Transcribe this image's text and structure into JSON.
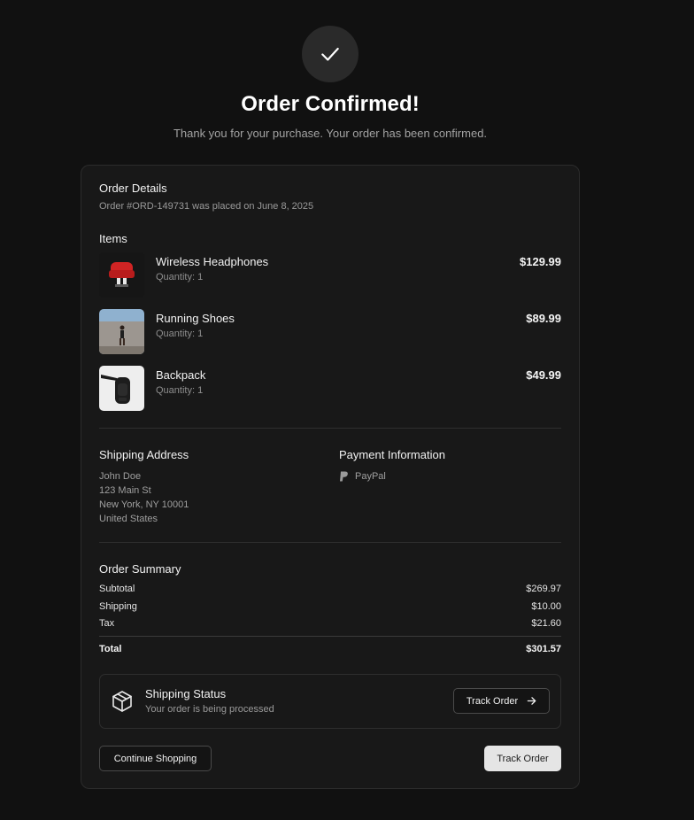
{
  "header": {
    "title": "Order Confirmed!",
    "subtitle": "Thank you for your purchase. Your order has been confirmed."
  },
  "order": {
    "heading": "Order Details",
    "placed_text": "Order #ORD-149731 was placed on June 8, 2025"
  },
  "items": {
    "heading": "Items",
    "list": [
      {
        "name": "Wireless Headphones",
        "quantity": "Quantity: 1",
        "price": "$129.99"
      },
      {
        "name": "Running Shoes",
        "quantity": "Quantity: 1",
        "price": "$89.99"
      },
      {
        "name": "Backpack",
        "quantity": "Quantity: 1",
        "price": "$49.99"
      }
    ]
  },
  "shipping_address": {
    "heading": "Shipping Address",
    "lines": [
      "John Doe",
      "123 Main St",
      "New York, NY 10001",
      "United States"
    ]
  },
  "payment": {
    "heading": "Payment Information",
    "method": "PayPal",
    "icon": "paypal-icon"
  },
  "summary": {
    "heading": "Order Summary",
    "rows": [
      {
        "label": "Subtotal",
        "value": "$269.97"
      },
      {
        "label": "Shipping",
        "value": "$10.00"
      },
      {
        "label": "Tax",
        "value": "$21.60"
      }
    ],
    "total_label": "Total",
    "total_value": "$301.57"
  },
  "shipping_status": {
    "title": "Shipping Status",
    "status": "Your order is being processed",
    "track_label": "Track Order",
    "icon": "package-icon"
  },
  "actions": {
    "continue_label": "Continue Shopping",
    "track_label": "Track Order"
  },
  "colors": {
    "background": "#111111",
    "card": "#181818",
    "primary_button": "#e5e5e5"
  }
}
